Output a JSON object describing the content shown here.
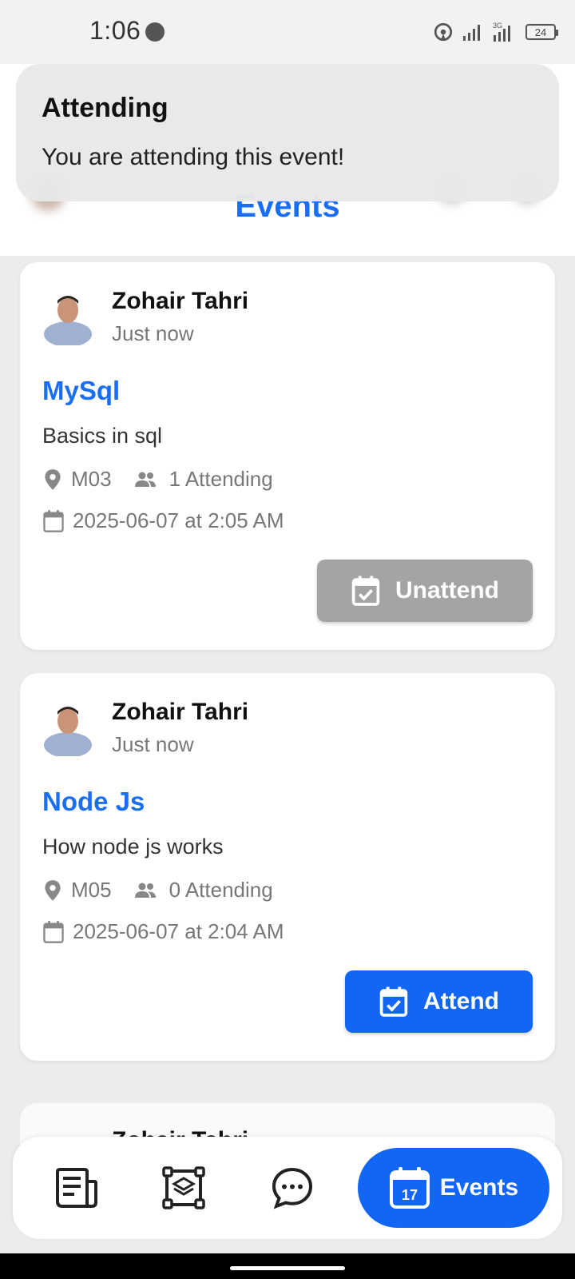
{
  "status_bar": {
    "time": "1:06",
    "battery": "24"
  },
  "header": {
    "title": "Events"
  },
  "toast": {
    "title": "Attending",
    "message": "You are attending this event!"
  },
  "events": [
    {
      "author": "Zohair Tahri",
      "time": "Just now",
      "title": "MySql",
      "description": "Basics in sql",
      "location": "M03",
      "attending": "1 Attending",
      "datetime": "2025-06-07 at 2:05 AM",
      "button": "Unattend"
    },
    {
      "author": "Zohair Tahri",
      "time": "Just now",
      "title": "Node Js",
      "description": "How node js works",
      "location": "M05",
      "attending": "0 Attending",
      "datetime": "2025-06-07 at 2:04 AM",
      "button": "Attend"
    }
  ],
  "partial_card": {
    "author": "Zohair Tahri"
  },
  "bottom_nav": {
    "items": [
      {
        "icon": "newspaper-icon"
      },
      {
        "icon": "layers-icon"
      },
      {
        "icon": "chat-icon"
      },
      {
        "icon": "calendar-icon",
        "label": "Events",
        "calendar_day": "17"
      }
    ]
  },
  "colors": {
    "accent": "#1166f5",
    "title_blue": "#1a6ef5",
    "unattend_gray": "#a4a4a4"
  }
}
